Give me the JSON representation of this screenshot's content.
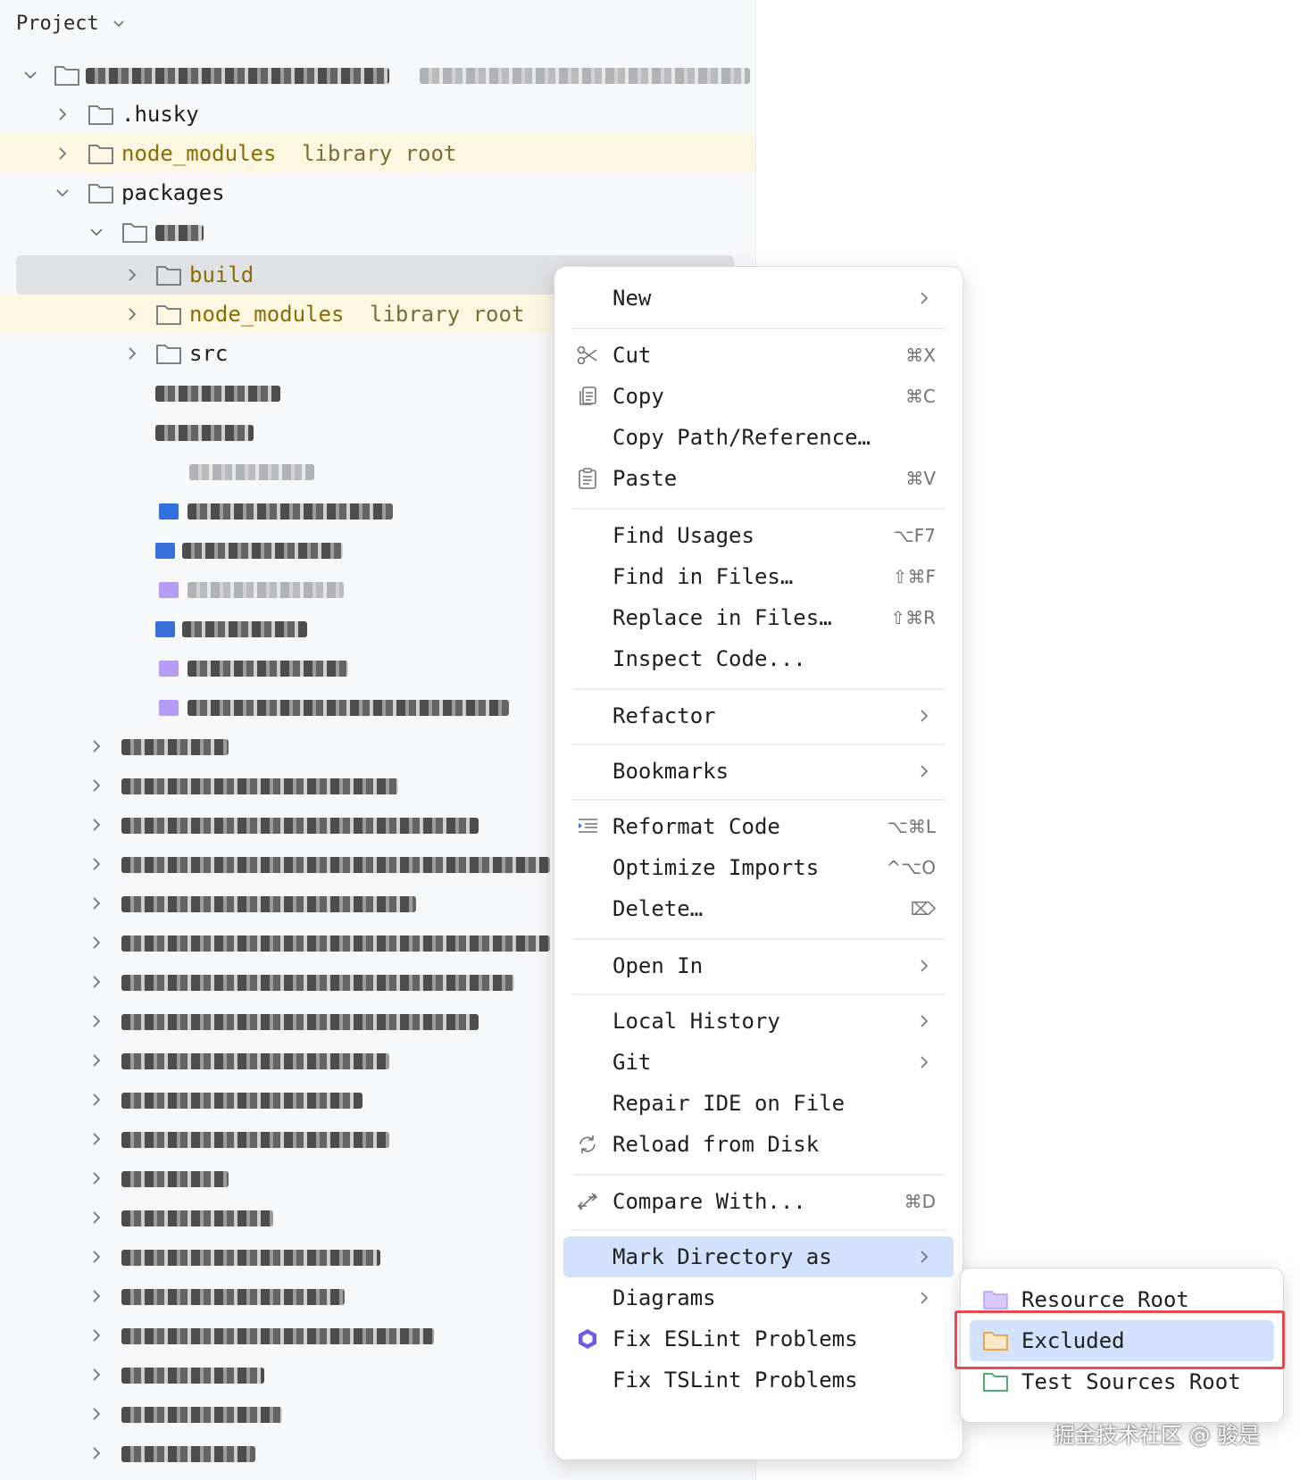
{
  "panel": {
    "title": "Project",
    "rows": [
      {
        "label": "",
        "hint": ""
      },
      {
        "label": ".husky",
        "hint": ""
      },
      {
        "label": "node_modules",
        "hint": "library root"
      },
      {
        "label": "packages",
        "hint": ""
      },
      {
        "label": "",
        "hint": ""
      },
      {
        "label": "build",
        "hint": ""
      },
      {
        "label": "node_modules",
        "hint": "library root"
      },
      {
        "label": "src",
        "hint": ""
      }
    ]
  },
  "context_menu": {
    "items": [
      {
        "label": "New",
        "shortcut": "",
        "submenu": true,
        "icon": ""
      },
      {
        "label": "Cut",
        "shortcut": "⌘X",
        "submenu": false,
        "icon": "scissors-icon"
      },
      {
        "label": "Copy",
        "shortcut": "⌘C",
        "submenu": false,
        "icon": "copy-icon"
      },
      {
        "label": "Copy Path/Reference…",
        "shortcut": "",
        "submenu": false,
        "icon": ""
      },
      {
        "label": "Paste",
        "shortcut": "⌘V",
        "submenu": false,
        "icon": "clipboard-icon"
      },
      {
        "label": "Find Usages",
        "shortcut": "⌥F7",
        "submenu": false,
        "icon": ""
      },
      {
        "label": "Find in Files…",
        "shortcut": "⇧⌘F",
        "submenu": false,
        "icon": ""
      },
      {
        "label": "Replace in Files…",
        "shortcut": "⇧⌘R",
        "submenu": false,
        "icon": ""
      },
      {
        "label": "Inspect Code...",
        "shortcut": "",
        "submenu": false,
        "icon": ""
      },
      {
        "label": "Refactor",
        "shortcut": "",
        "submenu": true,
        "icon": ""
      },
      {
        "label": "Bookmarks",
        "shortcut": "",
        "submenu": true,
        "icon": ""
      },
      {
        "label": "Reformat Code",
        "shortcut": "⌥⌘L",
        "submenu": false,
        "icon": "reformat-icon"
      },
      {
        "label": "Optimize Imports",
        "shortcut": "^⌥O",
        "submenu": false,
        "icon": ""
      },
      {
        "label": "Delete…",
        "shortcut": "⌦",
        "submenu": false,
        "icon": ""
      },
      {
        "label": "Open In",
        "shortcut": "",
        "submenu": true,
        "icon": ""
      },
      {
        "label": "Local History",
        "shortcut": "",
        "submenu": true,
        "icon": ""
      },
      {
        "label": "Git",
        "shortcut": "",
        "submenu": true,
        "icon": ""
      },
      {
        "label": "Repair IDE on File",
        "shortcut": "",
        "submenu": false,
        "icon": ""
      },
      {
        "label": "Reload from Disk",
        "shortcut": "",
        "submenu": false,
        "icon": "reload-icon"
      },
      {
        "label": "Compare With...",
        "shortcut": "⌘D",
        "submenu": false,
        "icon": "compare-icon"
      },
      {
        "label": "Mark Directory as",
        "shortcut": "",
        "submenu": true,
        "icon": ""
      },
      {
        "label": "Diagrams",
        "shortcut": "",
        "submenu": true,
        "icon": ""
      },
      {
        "label": "Fix ESLint Problems",
        "shortcut": "",
        "submenu": false,
        "icon": "eslint-icon"
      },
      {
        "label": "Fix TSLint Problems",
        "shortcut": "",
        "submenu": false,
        "icon": ""
      }
    ]
  },
  "submenu": {
    "items": [
      {
        "label": "Resource Root",
        "icon": "resource-root-folder-icon"
      },
      {
        "label": "Excluded",
        "icon": "excluded-folder-icon"
      },
      {
        "label": "Test Sources Root",
        "icon": "test-sources-folder-icon"
      }
    ]
  },
  "watermark": "掘金技术社区 @ 骏是",
  "colors": {
    "accent_selection": "#d2e2fc",
    "library_row": "#fdf6e0",
    "excluded_orange": "#e9a23b",
    "highlight_red": "#e5484d"
  }
}
